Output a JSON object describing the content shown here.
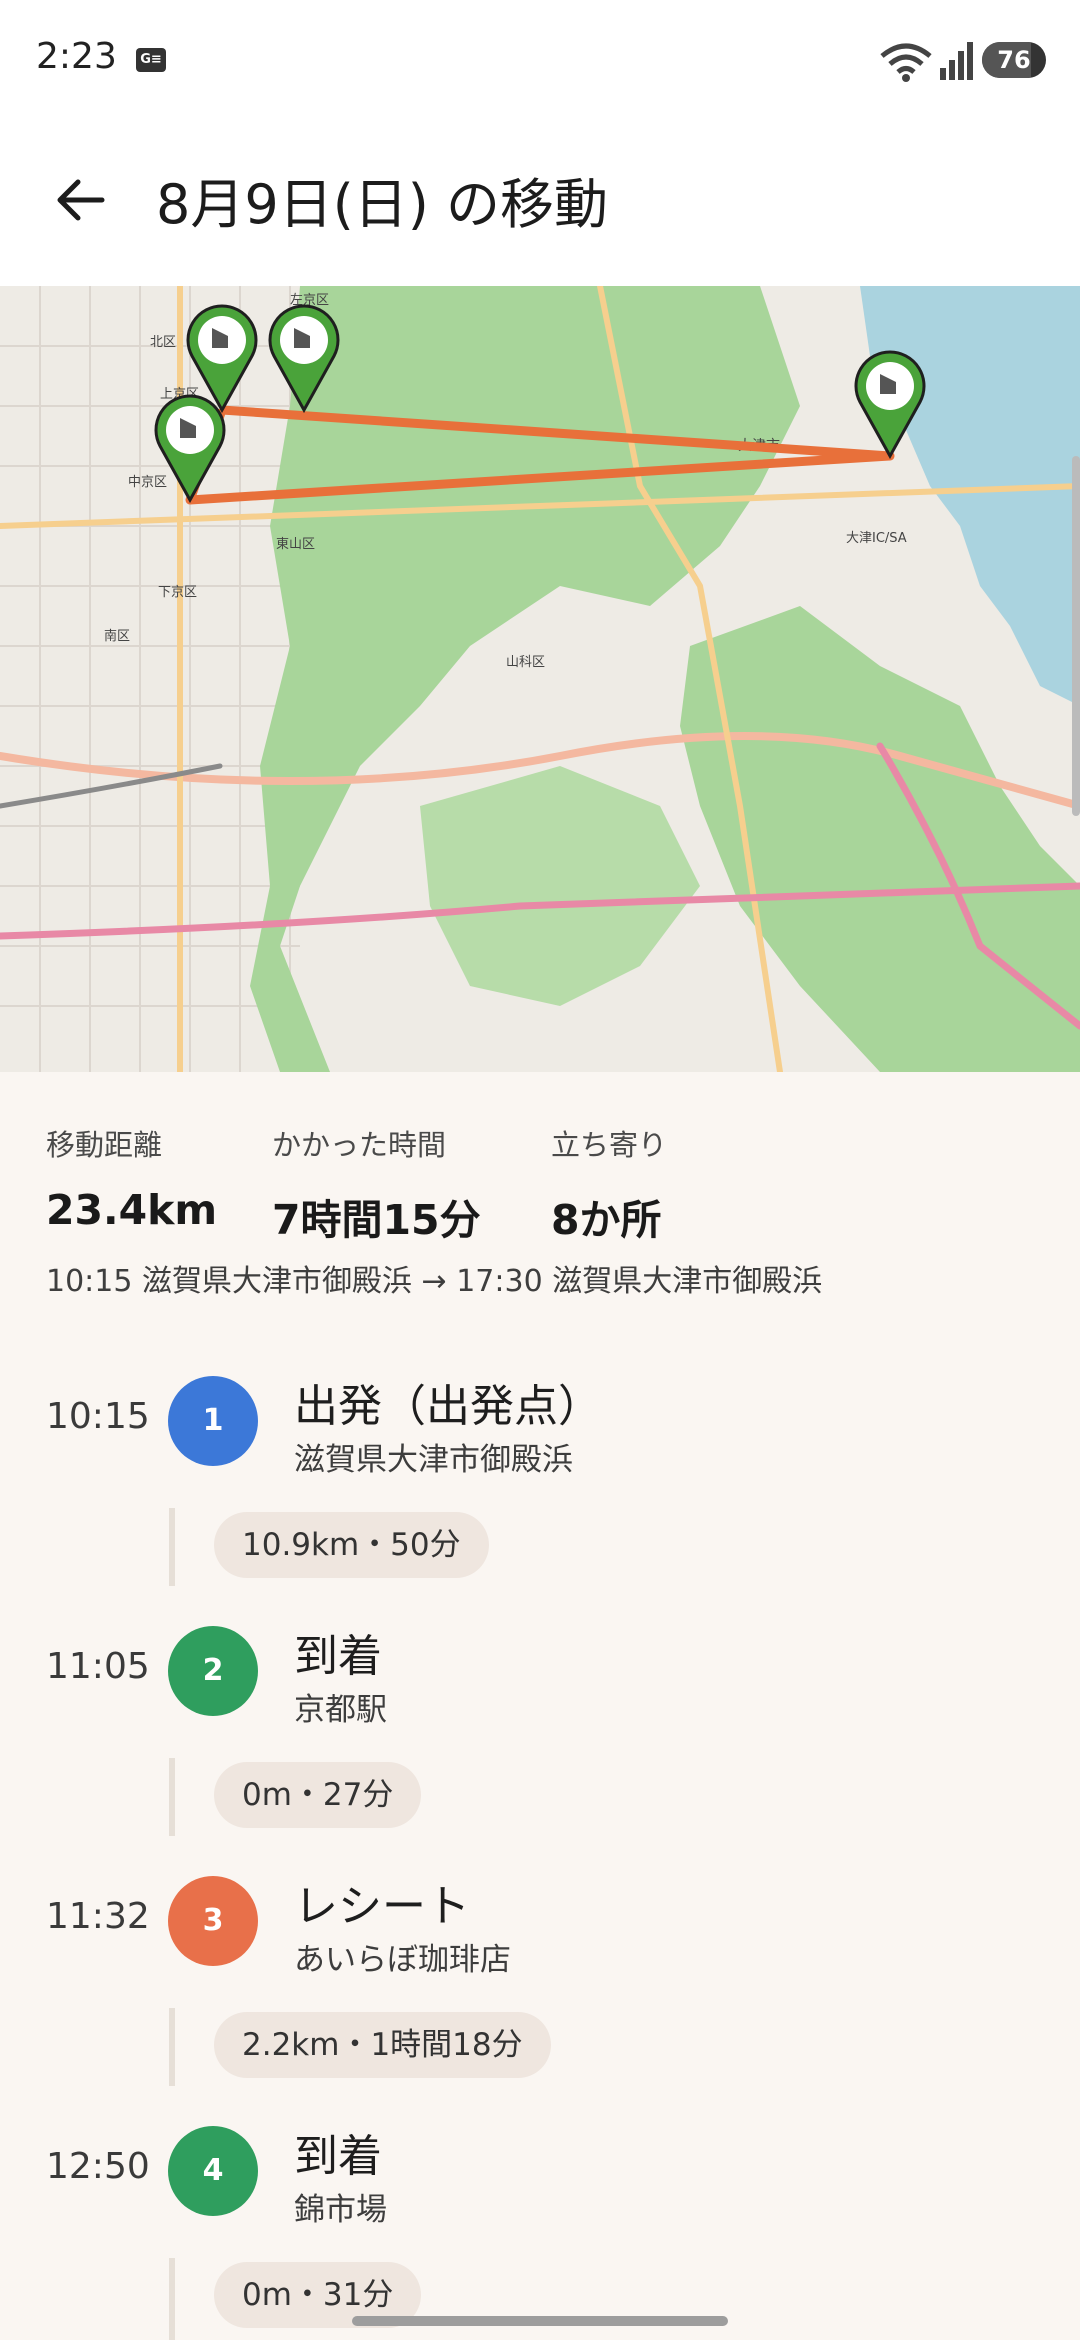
{
  "status_bar": {
    "time": "2:23",
    "badge": "G≡",
    "battery_level": "76",
    "battery_fraction": 0.76
  },
  "header": {
    "title": "8月9日(日) の移動",
    "back_icon": "arrow-left-icon"
  },
  "map": {
    "labels": {
      "sakyo": "左京区",
      "kita": "北区",
      "kamigyo": "上京区",
      "nakagyo": "中京区",
      "higashiyama": "東山区",
      "shimogyo": "下京区",
      "minami": "南区",
      "yamashina": "山科区",
      "otsu": "大津市",
      "otsu_ic": "大津IC/SA"
    },
    "route_color": "#e8703a",
    "pin_color": "#4aa33a",
    "pin_icon": "pointing-hand-icon"
  },
  "summary": {
    "distance_label": "移動距離",
    "distance_value": "23.4km",
    "duration_label": "かかった時間",
    "duration_value": "7時間15分",
    "stops_label": "立ち寄り",
    "stops_value": "8か所",
    "route_text": "10:15 滋賀県大津市御殿浜 → 17:30 滋賀県大津市御殿浜"
  },
  "timeline": {
    "items": [
      {
        "time": "10:15",
        "number": "1",
        "title": "出発（出発点）",
        "subtitle": "滋賀県大津市御殿浜",
        "color": "#3c78d8"
      },
      {
        "time": "11:05",
        "number": "2",
        "title": "到着",
        "subtitle": "京都駅",
        "color": "#2f9e5e"
      },
      {
        "time": "11:32",
        "number": "3",
        "title": "レシート",
        "subtitle": "あいらぼ珈琲店",
        "color": "#e8704a"
      },
      {
        "time": "12:50",
        "number": "4",
        "title": "到着",
        "subtitle": "錦市場",
        "color": "#2f9e5e"
      }
    ],
    "legs": [
      "10.9km・50分",
      "0m・27分",
      "2.2km・1時間18分",
      "0m・31分"
    ]
  }
}
